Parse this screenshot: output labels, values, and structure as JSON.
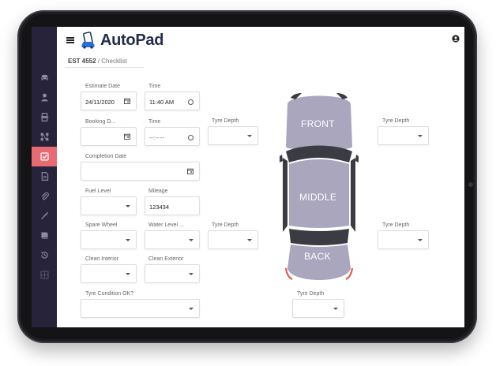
{
  "app": {
    "logo": "AutoPad"
  },
  "breadcrumb": {
    "ref": "EST 4552",
    "separator": "/",
    "page": "Checklist"
  },
  "sidebar": {
    "items": [
      {
        "icon": "car-icon",
        "active": false
      },
      {
        "icon": "person-icon",
        "active": false
      },
      {
        "icon": "steering-icon",
        "active": false
      },
      {
        "icon": "nodes-icon",
        "active": false
      },
      {
        "icon": "checklist-icon",
        "active": true
      },
      {
        "icon": "document-icon",
        "active": false
      },
      {
        "icon": "paperclip-icon",
        "active": false
      },
      {
        "icon": "brush-icon",
        "active": false
      },
      {
        "icon": "book-icon",
        "active": false
      },
      {
        "icon": "history-icon",
        "active": false
      },
      {
        "icon": "grid-icon",
        "active": false
      }
    ],
    "active_color": "#e86b73",
    "bg_color": "#27233a"
  },
  "form": {
    "estimate_date": {
      "label": "Estimate Date",
      "value": "24/11/2020"
    },
    "time_1": {
      "label": "Time",
      "value": "11:40 AM"
    },
    "booking_date": {
      "label": "Booking D...",
      "value": ""
    },
    "time_2": {
      "label": "Time",
      "value": "--:-- --"
    },
    "completion_date": {
      "label": "Completion Date",
      "value": ""
    },
    "fuel_level": {
      "label": "Fuel Level",
      "value": ""
    },
    "mileage": {
      "label": "Mileage",
      "value": "123434"
    },
    "spare_wheel": {
      "label": "Spare Wheel",
      "value": ""
    },
    "water_level": {
      "label": "Water Level ...",
      "value": ""
    },
    "clean_interior": {
      "label": "Clean Interior",
      "value": ""
    },
    "clean_exterior": {
      "label": "Clean Exterior",
      "value": ""
    },
    "tyre_condition": {
      "label": "Tyre Condition OK?",
      "value": ""
    },
    "tyre_depth_front_left": {
      "label": "Tyre Depth",
      "value": ""
    },
    "tyre_depth_front_right": {
      "label": "Tyre Depth",
      "value": ""
    },
    "tyre_depth_rear_left": {
      "label": "Tyre Depth",
      "value": ""
    },
    "tyre_depth_rear_right": {
      "label": "Tyre Depth",
      "value": ""
    },
    "tyre_depth_spare": {
      "label": "Tyre Depth",
      "value": ""
    }
  },
  "car_diagram": {
    "front": "FRONT",
    "middle": "MIDDLE",
    "back": "BACK",
    "body_color": "#a9a6bd",
    "dark_color": "#3b3b44",
    "accent_color": "#e8584a"
  }
}
